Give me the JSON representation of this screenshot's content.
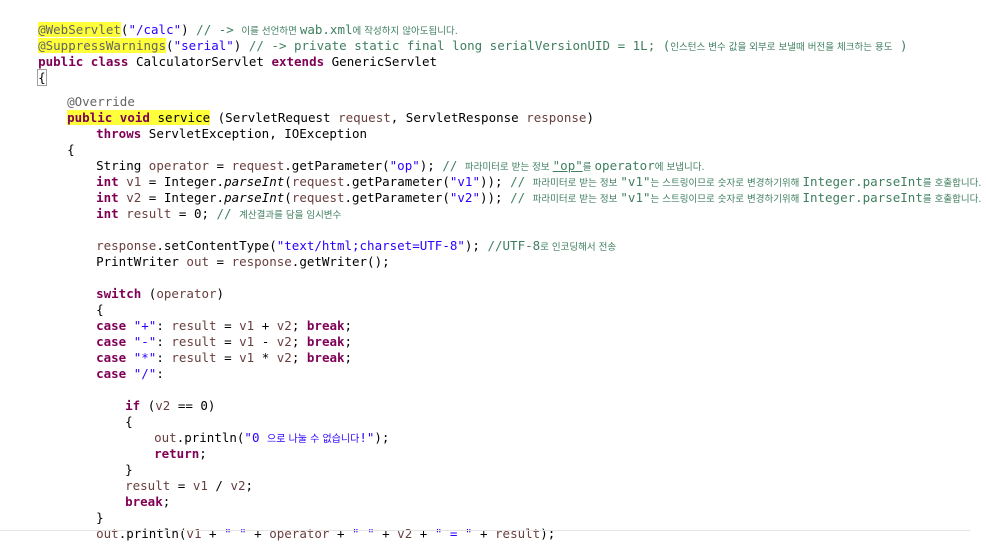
{
  "code": {
    "l1": {
      "annotation": "@WebServlet",
      "lp": "(",
      "str": "\"/calc\"",
      "rp": ")",
      "comment": " // -> ",
      "comment_ko1": "이를 선언하면 ",
      "comment_mid": "wab.xml",
      "comment_ko2": "에 작성하지 않아도됩니다."
    },
    "l2": {
      "annotation": "@SuppressWarnings",
      "lp": "(",
      "str": "\"serial\"",
      "rp": ")",
      "comment": " // -> private static final long serialVersionUID = 1L; (",
      "comment_ko": "인스턴스 변수 값을 외부로 보낼때 버전을 체크하는 용도",
      "comment_end": " )"
    },
    "l3": {
      "kw1": "public",
      "kw2": "class",
      "name": " CalculatorServlet ",
      "kw3": "extends",
      "parent": " GenericServlet"
    },
    "l4": {
      "brace": "{"
    },
    "l5": {
      "annotation": "@Override"
    },
    "l6": {
      "kw1": "public",
      "kw2": "void",
      "method": "service",
      "params_a": " (ServletRequest ",
      "param1": "request",
      "params_b": ", ServletResponse ",
      "param2": "response",
      "params_c": ")"
    },
    "l7": {
      "kw": "throws",
      "rest": " ServletException, IOException"
    },
    "l8": {
      "brace": "{"
    },
    "l9": {
      "a": "String ",
      "var": "operator",
      "b": " = ",
      "req": "request",
      "c": ".getParameter(",
      "str": "\"op\"",
      "d": "); ",
      "comment": "// ",
      "comment_ko1": "파라미터로 받는 정보 ",
      "comment_q": "\"op\"",
      "comment_ko2": "를 ",
      "comment_op": "operator",
      "comment_ko3": "에 보냅니다."
    },
    "l10": {
      "kw": "int",
      "a": " ",
      "var": "v1",
      "b": " = Integer.",
      "method": "parseInt",
      "c": "(",
      "req": "request",
      "d": ".getParameter(",
      "str": "\"v1\"",
      "e": ")); ",
      "comment": "// ",
      "comment_ko1": "파라미터로 받는 정보 ",
      "comment_q": "\"v1\"",
      "comment_ko2": "는 스트링이므로 숫자로 변경하기위해 ",
      "comment_m": "Integer.parseInt",
      "comment_ko3": "를 호출합니다."
    },
    "l11": {
      "kw": "int",
      "a": " ",
      "var": "v2",
      "b": " = Integer.",
      "method": "parseInt",
      "c": "(",
      "req": "request",
      "d": ".getParameter(",
      "str": "\"v2\"",
      "e": ")); ",
      "comment": "// ",
      "comment_ko1": "파라미터로 받는 정보 ",
      "comment_q": "\"v1\"",
      "comment_ko2": "는 스트링이므로 숫자로 변경하기위해 ",
      "comment_m": "Integer.parseInt",
      "comment_ko3": "를 호출합니다."
    },
    "l12": {
      "kw": "int",
      "a": " ",
      "var": "result",
      "b": " = 0; ",
      "comment": "// ",
      "comment_ko": "계산결과를 담을 임시변수"
    },
    "l13": {
      "resp": "response",
      "a": ".setContentType(",
      "str": "\"text/html;charset=UTF-8\"",
      "b": "); ",
      "comment": "//UTF-8",
      "comment_ko": "로 인코딩해서 전송"
    },
    "l14": {
      "a": "PrintWriter ",
      "var": "out",
      "b": " = ",
      "resp": "response",
      "c": ".getWriter();"
    },
    "l15": {
      "kw": "switch",
      "a": " (",
      "var": "operator",
      "b": ")"
    },
    "l16": {
      "brace": "{"
    },
    "l17": {
      "kw": "case",
      "a": " ",
      "str": "\"+\"",
      "b": ": ",
      "v0": "result",
      "c": " = ",
      "v1": "v1",
      "d": " + ",
      "v2": "v2",
      "e": "; ",
      "kw2": "break",
      "f": ";"
    },
    "l18": {
      "kw": "case",
      "a": " ",
      "str": "\"-\"",
      "b": ": ",
      "v0": "result",
      "c": " = ",
      "v1": "v1",
      "d": " - ",
      "v2": "v2",
      "e": "; ",
      "kw2": "break",
      "f": ";"
    },
    "l19": {
      "kw": "case",
      "a": " ",
      "str": "\"*\"",
      "b": ": ",
      "v0": "result",
      "c": " = ",
      "v1": "v1",
      "d": " * ",
      "v2": "v2",
      "e": "; ",
      "kw2": "break",
      "f": ";"
    },
    "l20": {
      "kw": "case",
      "a": " ",
      "str": "\"/\"",
      "b": ":"
    },
    "l21": {
      "kw": "if",
      "a": " (",
      "var": "v2",
      "b": " == 0)"
    },
    "l22": {
      "brace": "{"
    },
    "l23": {
      "var": "out",
      "a": ".println(",
      "str1": "\"0 ",
      "str_ko": "으로 나눌 수 없습니다",
      "str2": "!\"",
      "b": ");"
    },
    "l24": {
      "kw": "return",
      "a": ";"
    },
    "l25": {
      "brace": "}"
    },
    "l26": {
      "v0": "result",
      "a": " = ",
      "v1": "v1",
      "b": " / ",
      "v2": "v2",
      "c": ";"
    },
    "l27": {
      "kw": "break",
      "a": ";"
    },
    "l28": {
      "brace": "}"
    },
    "l29": {
      "var": "out",
      "a": ".println(",
      "v1": "v1",
      "b": " + ",
      "s1": "\" \"",
      "c": " + ",
      "op": "operator",
      "d": " + ",
      "s2": "\" \"",
      "e": " + ",
      "v2": "v2",
      "f": " + ",
      "s3": "\" = \"",
      "g": " + ",
      "res": "result",
      "h": ");"
    }
  },
  "colors": {
    "keyword": "#7f0055",
    "string": "#2a00ff",
    "comment": "#3f7f5f",
    "annotation": "#646464",
    "variable": "#6a3e3e",
    "highlight": "#ffff3a"
  }
}
